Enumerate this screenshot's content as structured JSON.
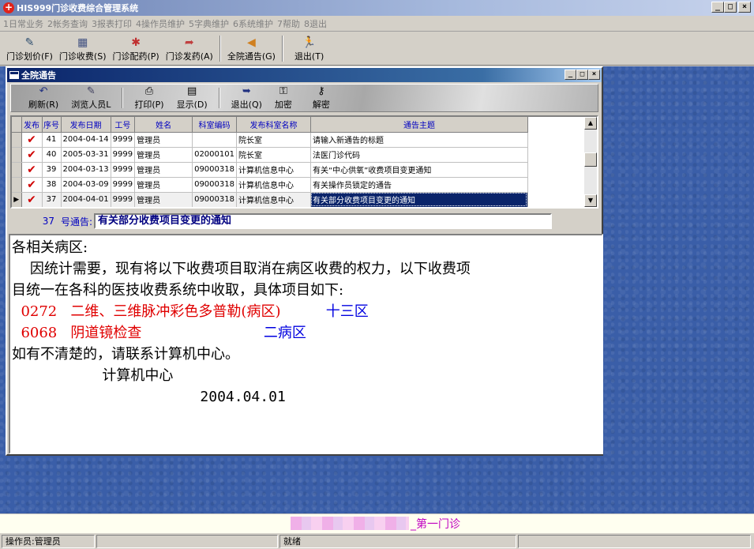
{
  "window": {
    "title": "HIS999门诊收费综合管理系统",
    "min_label": "_",
    "max_label": "□",
    "close_label": "×"
  },
  "menu": [
    "1日常业务",
    "2帐务查询",
    "3报表打印",
    "4操作员维护",
    "5字典维护",
    "6系统维护",
    "7帮助",
    "8退出"
  ],
  "toolbar": [
    {
      "label": "门诊划价(F)",
      "icon": "calculator-icon",
      "glyph": "✎"
    },
    {
      "label": "门诊收费(S)",
      "icon": "cash-register-icon",
      "glyph": "▦"
    },
    {
      "label": "门诊配药(P)",
      "icon": "medicine-icon",
      "glyph": "✱"
    },
    {
      "label": "门诊发药(A)",
      "icon": "dispense-icon",
      "glyph": "➦"
    },
    {
      "label": "全院通告(G)",
      "icon": "announcement-icon",
      "glyph": "◀"
    },
    {
      "label": "退出(T)",
      "icon": "exit-icon",
      "glyph": "🏃"
    }
  ],
  "child_window": {
    "title": "全院通告",
    "toolbar": [
      {
        "label": "刷新(R)",
        "icon": "refresh-icon",
        "glyph": "↶"
      },
      {
        "label": "浏览人员L",
        "icon": "browse-users-icon",
        "glyph": "✎"
      },
      {
        "label": "打印(P)",
        "icon": "printer-icon",
        "glyph": "⎙"
      },
      {
        "label": "显示(D)",
        "icon": "display-icon",
        "glyph": "▤"
      },
      {
        "label": "退出(Q)",
        "icon": "exit-icon",
        "glyph": "➥"
      },
      {
        "label": "加密",
        "icon": "encrypt-icon",
        "glyph": "⚿"
      },
      {
        "label": "解密",
        "icon": "decrypt-icon",
        "glyph": "⚷"
      }
    ]
  },
  "grid": {
    "columns": [
      "发布",
      "序号",
      "发布日期",
      "工号",
      "姓名",
      "科室编码",
      "发布科室名称",
      "通告主题"
    ],
    "rows": [
      {
        "check": "✔",
        "seq": "41",
        "date": "2004-04-14",
        "emp_no": "9999",
        "name": "管理员",
        "dept_code": "",
        "dept_name": "院长室",
        "subject": "请输入新通告的标题"
      },
      {
        "check": "✔",
        "seq": "40",
        "date": "2005-03-31",
        "emp_no": "9999",
        "name": "管理员",
        "dept_code": "02000101",
        "dept_name": "院长室",
        "subject": "法医门诊代码"
      },
      {
        "check": "✔",
        "seq": "39",
        "date": "2004-03-13",
        "emp_no": "9999",
        "name": "管理员",
        "dept_code": "09000318",
        "dept_name": "计算机信息中心",
        "subject": "有关“中心供氧”收费项目变更通知"
      },
      {
        "check": "✔",
        "seq": "38",
        "date": "2004-03-09",
        "emp_no": "9999",
        "name": "管理员",
        "dept_code": "09000318",
        "dept_name": "计算机信息中心",
        "subject": "有关操作员锁定的通告"
      },
      {
        "check": "✔",
        "seq": "37",
        "date": "2004-04-01",
        "emp_no": "9999",
        "name": "管理员",
        "dept_code": "09000318",
        "dept_name": "计算机信息中心",
        "subject": "有关部分收费项目变更的通知"
      }
    ],
    "row_indicator": "▶"
  },
  "notice": {
    "number": "37",
    "label": "号通告:",
    "title": "有关部分收费项目变更的通知"
  },
  "content": {
    "line1": "各相关病区:",
    "line2": "    因统计需要，现有将以下收费项目取消在病区收费的权力，以下收费项",
    "line3": "目统一在各科的医技收费系统中收取，具体项目如下:",
    "item1_code": "  0272",
    "item1_name": "   二维、三维脉冲彩色多普勒(病区)",
    "item1_ward": "          十三区",
    "item2_code": "  6068",
    "item2_name": "   阴道镜检查",
    "item2_ward": "                           二病区",
    "line6": "如有不清楚的，请联系计算机中心。",
    "signature": "                    计算机中心",
    "date": "                      2004.04.01"
  },
  "footer": {
    "hospital_suffix": "_第一门诊"
  },
  "status": {
    "operator": "操作员:管理员",
    "panel2": "",
    "state": "就绪",
    "panel4": ""
  }
}
